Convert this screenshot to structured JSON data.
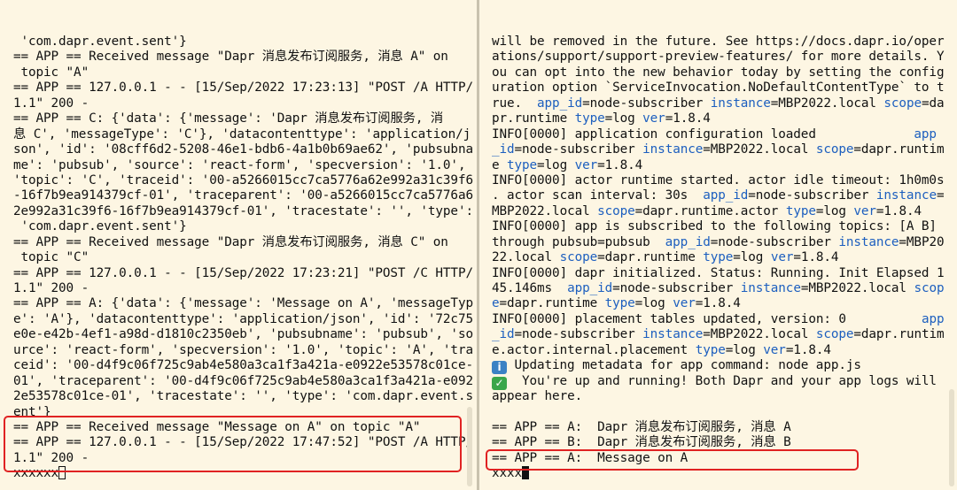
{
  "left_pane": {
    "lines": [
      " 'com.dapr.event.sent'}",
      "== APP == Received message \"Dapr 消息发布订阅服务, 消息 A\" on",
      " topic \"A\"",
      "== APP == 127.0.0.1 - - [15/Sep/2022 17:23:13] \"POST /A HTTP/",
      "1.1\" 200 -",
      "== APP == C: {'data': {'message': 'Dapr 消息发布订阅服务, 消",
      "息 C', 'messageType': 'C'}, 'datacontenttype': 'application/j",
      "son', 'id': '08cff6d2-5208-46e1-bdb6-4a1b0b69ae62', 'pubsubna",
      "me': 'pubsub', 'source': 'react-form', 'specversion': '1.0',",
      "'topic': 'C', 'traceid': '00-a5266015cc7ca5776a62e992a31c39f6",
      "-16f7b9ea914379cf-01', 'traceparent': '00-a5266015cc7ca5776a6",
      "2e992a31c39f6-16f7b9ea914379cf-01', 'tracestate': '', 'type':",
      " 'com.dapr.event.sent'}",
      "== APP == Received message \"Dapr 消息发布订阅服务, 消息 C\" on",
      " topic \"C\"",
      "== APP == 127.0.0.1 - - [15/Sep/2022 17:23:21] \"POST /C HTTP/",
      "1.1\" 200 -",
      "== APP == A: {'data': {'message': 'Message on A', 'messageTyp",
      "e': 'A'}, 'datacontenttype': 'application/json', 'id': '72c75",
      "e0e-e42b-4ef1-a98d-d1810c2350eb', 'pubsubname': 'pubsub', 'so",
      "urce': 'react-form', 'specversion': '1.0', 'topic': 'A', 'tra",
      "ceid': '00-d4f9c06f725c9ab4e580a3ca1f3a421a-e0922e53578c01ce-",
      "01', 'traceparent': '00-d4f9c06f725c9ab4e580a3ca1f3a421a-e092",
      "2e53578c01ce-01', 'tracestate': '', 'type': 'com.dapr.event.s",
      "ent'}",
      "== APP == Received message \"Message on A\" on topic \"A\"",
      "== APP == 127.0.0.1 - - [15/Sep/2022 17:47:52] \"POST /A HTTP/",
      "1.1\" 200 -"
    ],
    "prompt_text": "xxxxxx"
  },
  "right_pane": {
    "lines": [
      [
        [
          "t",
          "will be removed in the future. See https://docs.dapr.io/oper"
        ]
      ],
      [
        [
          "t",
          "ations/support/support-preview-features/ for more details. Y"
        ]
      ],
      [
        [
          "t",
          "ou can opt into the new behavior today by setting the config"
        ]
      ],
      [
        [
          "t",
          "uration option `ServiceInvocation.NoDefaultContentType` to t"
        ]
      ],
      [
        [
          "t",
          "rue.  "
        ],
        [
          "k",
          "app_id"
        ],
        [
          "t",
          "=node-subscriber "
        ],
        [
          "k",
          "instance"
        ],
        [
          "t",
          "=MBP2022.local "
        ],
        [
          "k",
          "scope"
        ],
        [
          "t",
          "=da"
        ]
      ],
      [
        [
          "t",
          "pr.runtime "
        ],
        [
          "k",
          "type"
        ],
        [
          "t",
          "=log "
        ],
        [
          "k",
          "ver"
        ],
        [
          "t",
          "=1.8.4"
        ]
      ],
      [
        [
          "t",
          "INFO[0000] application configuration loaded             "
        ],
        [
          "k",
          "app"
        ]
      ],
      [
        [
          "k",
          "_id"
        ],
        [
          "t",
          "=node-subscriber "
        ],
        [
          "k",
          "instance"
        ],
        [
          "t",
          "=MBP2022.local "
        ],
        [
          "k",
          "scope"
        ],
        [
          "t",
          "=dapr.runtim"
        ]
      ],
      [
        [
          "t",
          "e "
        ],
        [
          "k",
          "type"
        ],
        [
          "t",
          "=log "
        ],
        [
          "k",
          "ver"
        ],
        [
          "t",
          "=1.8.4"
        ]
      ],
      [
        [
          "t",
          "INFO[0000] actor runtime started. actor idle timeout: 1h0m0s"
        ]
      ],
      [
        [
          "t",
          ". actor scan interval: 30s  "
        ],
        [
          "k",
          "app_id"
        ],
        [
          "t",
          "=node-subscriber "
        ],
        [
          "k",
          "instance"
        ],
        [
          "t",
          "="
        ]
      ],
      [
        [
          "t",
          "MBP2022.local "
        ],
        [
          "k",
          "scope"
        ],
        [
          "t",
          "=dapr.runtime.actor "
        ],
        [
          "k",
          "type"
        ],
        [
          "t",
          "=log "
        ],
        [
          "k",
          "ver"
        ],
        [
          "t",
          "=1.8.4"
        ]
      ],
      [
        [
          "t",
          "INFO[0000] app is subscribed to the following topics: [A B]"
        ]
      ],
      [
        [
          "t",
          "through pubsub=pubsub  "
        ],
        [
          "k",
          "app_id"
        ],
        [
          "t",
          "=node-subscriber "
        ],
        [
          "k",
          "instance"
        ],
        [
          "t",
          "=MBP20"
        ]
      ],
      [
        [
          "t",
          "22.local "
        ],
        [
          "k",
          "scope"
        ],
        [
          "t",
          "=dapr.runtime "
        ],
        [
          "k",
          "type"
        ],
        [
          "t",
          "=log "
        ],
        [
          "k",
          "ver"
        ],
        [
          "t",
          "=1.8.4"
        ]
      ],
      [
        [
          "t",
          "INFO[0000] dapr initialized. Status: Running. Init Elapsed 1"
        ]
      ],
      [
        [
          "t",
          "45.146ms  "
        ],
        [
          "k",
          "app_id"
        ],
        [
          "t",
          "=node-subscriber "
        ],
        [
          "k",
          "instance"
        ],
        [
          "t",
          "=MBP2022.local "
        ],
        [
          "k",
          "scop"
        ]
      ],
      [
        [
          "k",
          "e"
        ],
        [
          "t",
          "=dapr.runtime "
        ],
        [
          "k",
          "type"
        ],
        [
          "t",
          "=log "
        ],
        [
          "k",
          "ver"
        ],
        [
          "t",
          "=1.8.4"
        ]
      ],
      [
        [
          "t",
          "INFO[0000] placement tables updated, version: 0          "
        ],
        [
          "k",
          "app"
        ]
      ],
      [
        [
          "k",
          "_id"
        ],
        [
          "t",
          "=node-subscriber "
        ],
        [
          "k",
          "instance"
        ],
        [
          "t",
          "=MBP2022.local "
        ],
        [
          "k",
          "scope"
        ],
        [
          "t",
          "=dapr.runtim"
        ]
      ],
      [
        [
          "t",
          "e.actor.internal.placement "
        ],
        [
          "k",
          "type"
        ],
        [
          "t",
          "=log "
        ],
        [
          "k",
          "ver"
        ],
        [
          "t",
          "=1.8.4"
        ]
      ],
      [
        [
          "i",
          "info-icon"
        ],
        [
          "t",
          " Updating metadata for app command: node app.js"
        ]
      ],
      [
        [
          "i",
          "check-icon"
        ],
        [
          "t",
          "  You're up and running! Both Dapr and your app logs will"
        ]
      ],
      [
        [
          "t",
          "appear here."
        ]
      ],
      [
        [
          "t",
          ""
        ]
      ],
      [
        [
          "t",
          "== APP == A:  Dapr 消息发布订阅服务, 消息 A"
        ]
      ],
      [
        [
          "t",
          "== APP == B:  Dapr 消息发布订阅服务, 消息 B"
        ]
      ],
      [
        [
          "t",
          "== APP == A:  Message on A"
        ]
      ]
    ],
    "prompt_text": "xxxx"
  },
  "icons": {
    "info-icon": "i",
    "check-icon": "✓"
  },
  "colors": {
    "background": "#fdf6e3",
    "keyword": "#1d5fbf",
    "highlight": "#e02222"
  }
}
